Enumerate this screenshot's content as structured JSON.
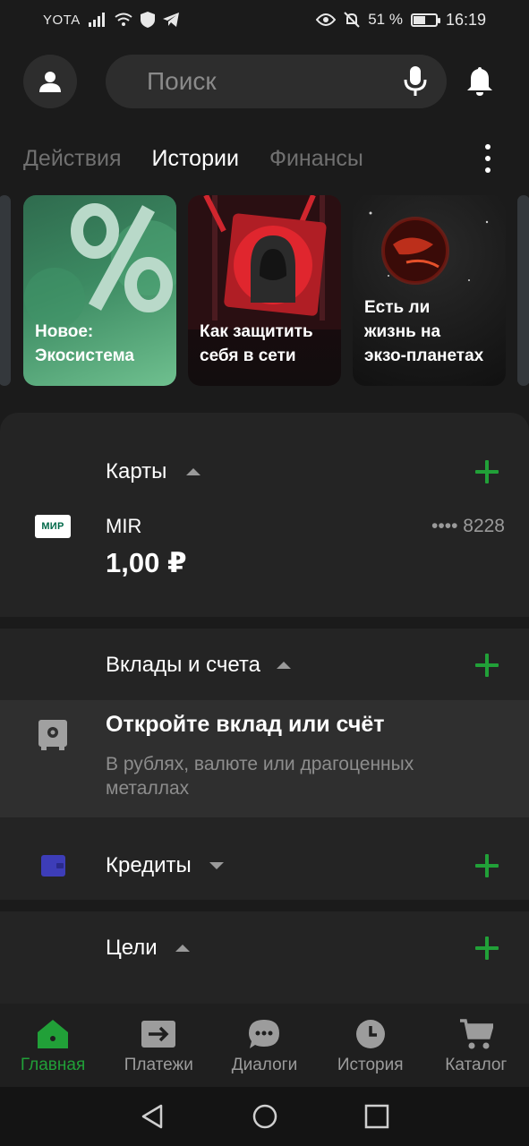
{
  "status_bar": {
    "carrier": "YOTA",
    "battery": "51 %",
    "battery_level": 0.51,
    "time": "16:19"
  },
  "header": {
    "search_placeholder": "Поиск"
  },
  "tabs": [
    {
      "label": "Действия",
      "active": false
    },
    {
      "label": "Истории",
      "active": true
    },
    {
      "label": "Финансы",
      "active": false
    }
  ],
  "stories": [
    {
      "text_line1": "Новое:",
      "text_line2": "Экосистема",
      "text_line3": ""
    },
    {
      "text_line1": "Как защитить",
      "text_line2": "себя в сети",
      "text_line3": ""
    },
    {
      "text_line1": "Есть ли",
      "text_line2": "жизнь на",
      "text_line3": "экзо-планетах"
    }
  ],
  "sections": {
    "cards": {
      "title": "Карты",
      "card": {
        "logo_text": "МИР",
        "name": "MIR",
        "number": "•••• 8228",
        "balance": "1,00 ₽"
      }
    },
    "deposits": {
      "title": "Вклады и счета",
      "promo_title": "Откройте вклад или счёт",
      "promo_subtitle": "В рублях, валюте или драгоценных металлах"
    },
    "credits": {
      "title": "Кредиты"
    },
    "goals": {
      "title": "Цели"
    }
  },
  "bottom_nav": [
    {
      "label": "Главная",
      "icon": "home-icon",
      "active": true
    },
    {
      "label": "Платежи",
      "icon": "payments-icon",
      "active": false
    },
    {
      "label": "Диалоги",
      "icon": "dialogs-icon",
      "active": false
    },
    {
      "label": "История",
      "icon": "clock-icon",
      "active": false
    },
    {
      "label": "Каталог",
      "icon": "cart-icon",
      "active": false
    }
  ],
  "colors": {
    "accent": "#21a038",
    "background": "#1b1b1b",
    "sheet": "#242424"
  }
}
